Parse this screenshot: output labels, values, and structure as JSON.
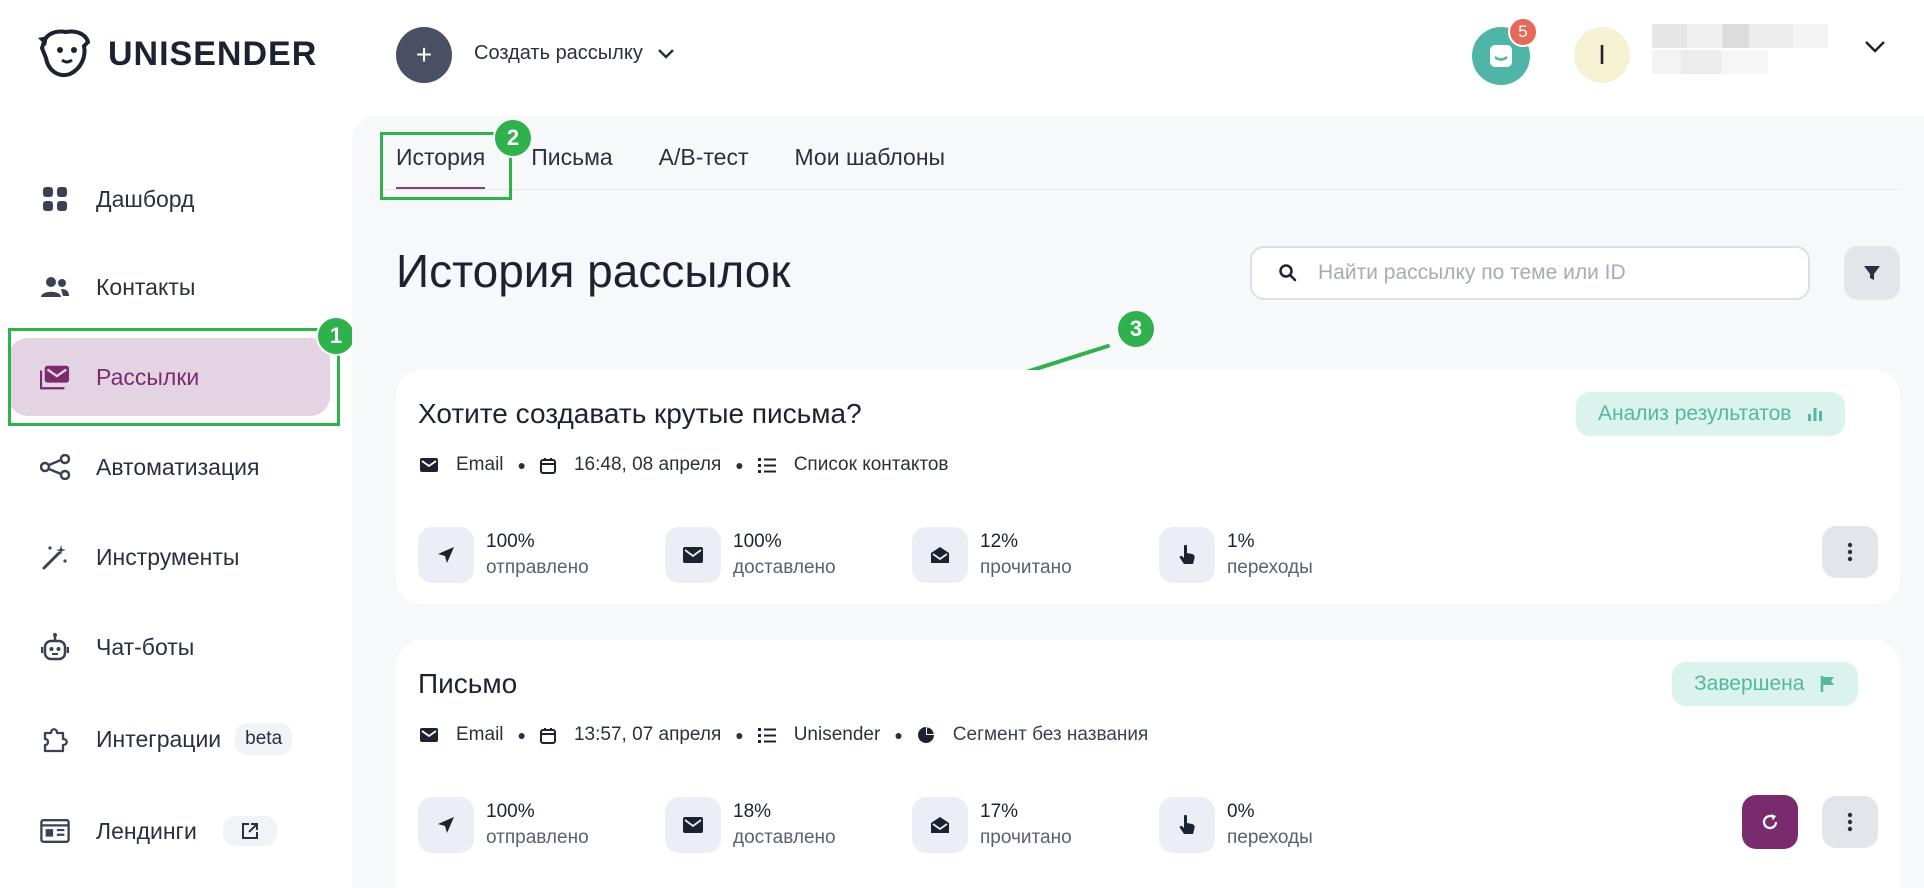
{
  "brand": {
    "name": "UNISENDER"
  },
  "header": {
    "create_icon": "plus-icon",
    "create_label": "Создать рассылку",
    "chat_count": "5",
    "avatar_initial": "I"
  },
  "sidebar": {
    "items": [
      {
        "label": "Дашборд",
        "icon": "dashboard-icon"
      },
      {
        "label": "Контакты",
        "icon": "contacts-icon"
      },
      {
        "label": "Рассылки",
        "icon": "mail-icon",
        "active": true
      },
      {
        "label": "Автоматизация",
        "icon": "automation-icon"
      },
      {
        "label": "Инструменты",
        "icon": "magic-wand-icon"
      },
      {
        "label": "Чат-боты",
        "icon": "robot-icon"
      },
      {
        "label": "Интеграции",
        "icon": "puzzle-icon",
        "badge": "beta"
      },
      {
        "label": "Лендинги",
        "icon": "landing-icon",
        "badge_icon": "external-link-icon"
      }
    ]
  },
  "tabs": [
    "История",
    "Письма",
    "А/В-тест",
    "Мои шаблоны"
  ],
  "page_title": "История рассылок",
  "search": {
    "placeholder": "Найти рассылку по теме или ID",
    "value": ""
  },
  "campaigns": [
    {
      "title": "Хотите создавать крутые письма?",
      "type": "Email",
      "datetime": "16:48, 08 апреля",
      "list": "Список контактов",
      "status": "Анализ результатов",
      "stats": [
        {
          "value": "100%",
          "label": "отправлено"
        },
        {
          "value": "100%",
          "label": "доставлено"
        },
        {
          "value": "12%",
          "label": "прочитано"
        },
        {
          "value": "1%",
          "label": "переходы"
        }
      ]
    },
    {
      "title": "Письмо",
      "type": "Email",
      "datetime": "13:57, 07 апреля",
      "list": "Unisender",
      "segment": "Сегмент без названия",
      "status": "Завершена",
      "stats": [
        {
          "value": "100%",
          "label": "отправлено"
        },
        {
          "value": "18%",
          "label": "доставлено"
        },
        {
          "value": "17%",
          "label": "прочитано"
        },
        {
          "value": "0%",
          "label": "переходы"
        }
      ]
    }
  ],
  "annotations": [
    "1",
    "2",
    "3"
  ],
  "colors": {
    "accent": "#7a2b6e",
    "active_bg": "#e4d3e2",
    "annotation": "#2fb24c",
    "status_bg": "#daf3ec",
    "status_text": "#56b79f",
    "chat": "#4fb5a7"
  }
}
